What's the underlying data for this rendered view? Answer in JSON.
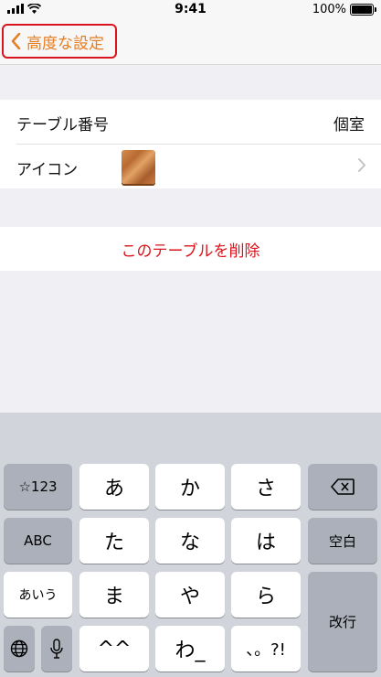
{
  "status_bar": {
    "time": "9:41",
    "battery": "100%"
  },
  "nav": {
    "back_label": "高度な設定"
  },
  "settings": {
    "table_number_label": "テーブル番号",
    "table_number_value": "個室",
    "icon_label": "アイコン"
  },
  "delete_label": "このテーブルを削除",
  "keyboard": {
    "row1": [
      "☆123",
      "あ",
      "か",
      "さ"
    ],
    "row2": [
      "ABC",
      "た",
      "な",
      "は",
      "空白"
    ],
    "row3": [
      "あいう",
      "ま",
      "や",
      "ら",
      "改行"
    ],
    "row4": [
      "^^",
      "わ_",
      "、。?!"
    ]
  },
  "colors": {
    "accent": "#e67e22",
    "destructive": "#d9141d"
  }
}
